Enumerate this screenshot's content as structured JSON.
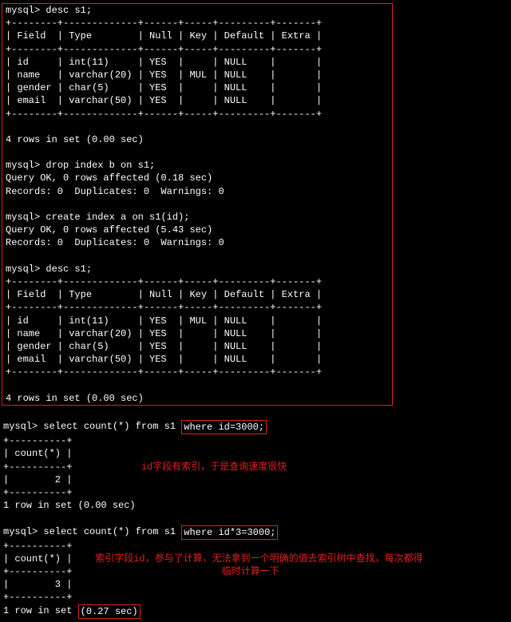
{
  "prompt": "mysql>",
  "cmds": {
    "desc1": "desc s1;",
    "drop": "drop index b on s1;",
    "create": "create index a on s1(id);",
    "desc2": "desc s1;",
    "sel1_pre": "select count(*) from s1 ",
    "sel1_where": "where id=3000;",
    "sel2_pre": "select count(*) from s1 ",
    "sel2_where": "where id*3=3000;"
  },
  "tbl_hdr": "| Field  | Type        | Null | Key | Default | Extra |",
  "tbl_sep": "+--------+-------------+------+-----+---------+-------+",
  "desc1_rows": [
    "| id     | int(11)     | YES  |     | NULL    |       |",
    "| name   | varchar(20) | YES  | MUL | NULL    |       |",
    "| gender | char(5)     | YES  |     | NULL    |       |",
    "| email  | varchar(50) | YES  |     | NULL    |       |"
  ],
  "desc2_rows": [
    "| id     | int(11)     | YES  | MUL | NULL    |       |",
    "| name   | varchar(20) | YES  |     | NULL    |       |",
    "| gender | char(5)     | YES  |     | NULL    |       |",
    "| email  | varchar(50) | YES  |     | NULL    |       |"
  ],
  "rows_in_set_000": "4 rows in set (0.00 sec)",
  "drop_ok": "Query OK, 0 rows affected (0.18 sec)",
  "create_ok": "Query OK, 0 rows affected (5.43 sec)",
  "records_line": "Records: 0  Duplicates: 0  Warnings: 0",
  "count_sep": "+----------+",
  "count_hdr": "| count(*) |",
  "count_val1": "|        2 |",
  "count_val2": "|        3 |",
  "one_row_000": "1 row in set (0.00 sec)",
  "one_row_027_pre": "1 row in set ",
  "one_row_027_box": "(0.27 sec)",
  "anno1": "id字段有索引，于是查询速度很快",
  "anno2_a": "索引字段id，参与了计算，无法拿到一个明确的值去索引树中查找，每次都得",
  "anno2_b": "临时计算一下",
  "blank": " "
}
